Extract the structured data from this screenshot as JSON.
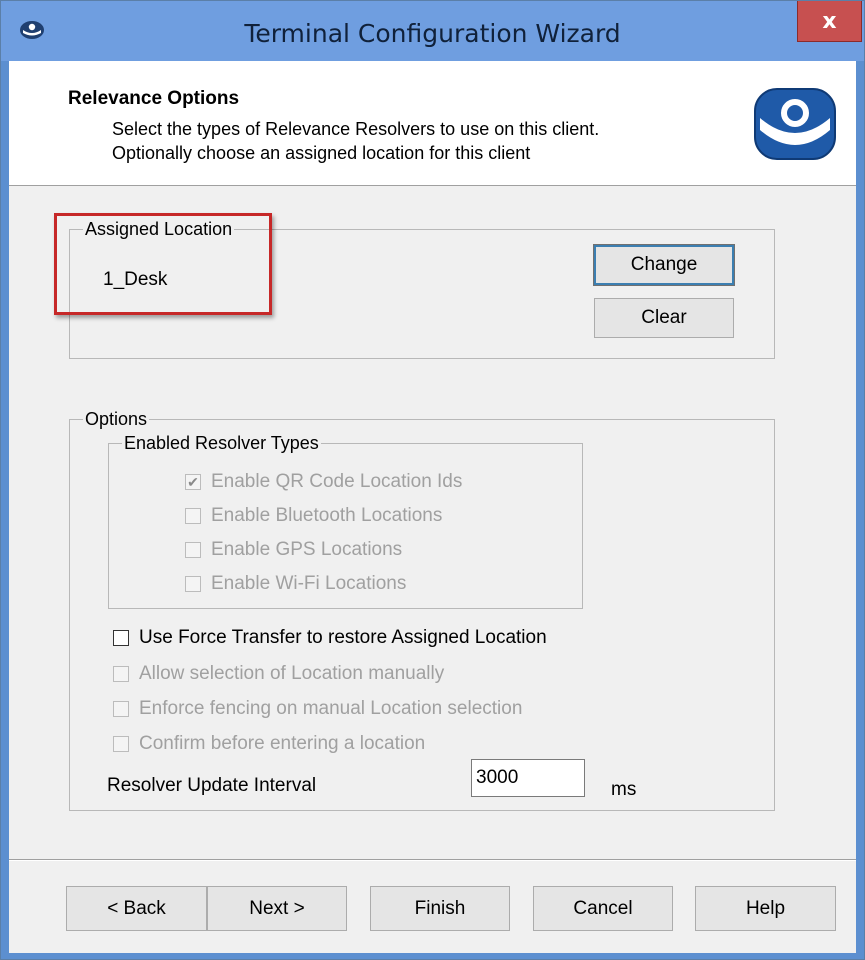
{
  "window": {
    "title": "Terminal Configuration Wizard",
    "close_label": "x",
    "app_icon": "thinmanager-small-icon"
  },
  "header": {
    "title": "Relevance Options",
    "line1": "Select the types of Relevance Resolvers to use on this client.",
    "line2": "Optionally choose an assigned location for this client",
    "logo": "thinmanager-logo-icon"
  },
  "assigned_location": {
    "legend": "Assigned Location",
    "value": "1_Desk",
    "change_label": "Change",
    "clear_label": "Clear"
  },
  "options": {
    "legend": "Options",
    "resolver_types": {
      "legend": "Enabled Resolver Types",
      "items": [
        {
          "label": "Enable QR Code Location Ids",
          "checked": true,
          "enabled": false
        },
        {
          "label": "Enable Bluetooth Locations",
          "checked": false,
          "enabled": false
        },
        {
          "label": "Enable GPS Locations",
          "checked": false,
          "enabled": false
        },
        {
          "label": "Enable Wi-Fi Locations",
          "checked": false,
          "enabled": false
        }
      ]
    },
    "force_transfer": {
      "label": "Use Force Transfer to restore Assigned Location",
      "checked": false,
      "enabled": true
    },
    "manual_selection": {
      "label": "Allow selection of Location manually",
      "checked": false,
      "enabled": false
    },
    "enforce_fencing": {
      "label": "Enforce fencing on manual Location selection",
      "checked": false,
      "enabled": false
    },
    "confirm_entering": {
      "label": "Confirm before entering a location",
      "checked": false,
      "enabled": false
    },
    "interval": {
      "label": "Resolver Update Interval",
      "value": "3000",
      "units": "ms"
    }
  },
  "footer": {
    "back_label": "< Back",
    "next_label": "Next >",
    "finish_label": "Finish",
    "cancel_label": "Cancel",
    "help_label": "Help"
  },
  "colors": {
    "title_bar": "#6f9ee0",
    "close_button": "#c75050",
    "highlight_border": "#c62828",
    "logo_blue": "#1f5aa8"
  }
}
